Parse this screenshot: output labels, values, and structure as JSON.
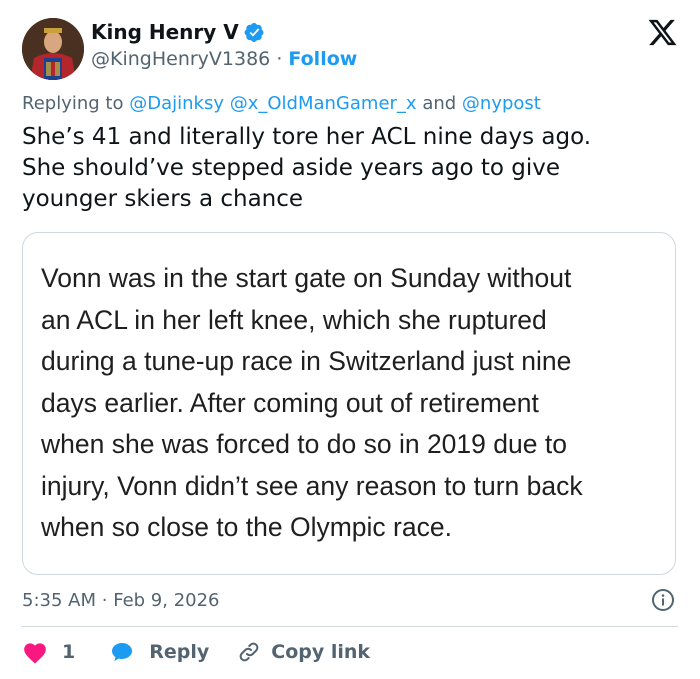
{
  "author": {
    "display_name": "King Henry V",
    "handle": "@KingHenryV1386",
    "separator": "·",
    "follow_label": "Follow",
    "verified": true,
    "avatar_icon": "royal-portrait-avatar"
  },
  "platform_icon": "x-logo-icon",
  "replying": {
    "prefix": "Replying to",
    "mention_1": "@Dajinksy",
    "mention_2": "@x_OldManGamer_x",
    "conjunction": "and",
    "mention_3": "@nypost"
  },
  "tweet": {
    "text": "She’s 41 and literally tore her ACL nine days ago.\nShe should’ve stepped aside years ago to give\nyounger skiers a chance"
  },
  "quoted_image": {
    "text": "Vonn was in the start gate on Sunday without\nan ACL in her left knee, which she ruptured\nduring a tune-up race in Switzerland just nine\ndays earlier. After coming out of retirement\nwhen she was forced to do so in 2019 due to\ninjury, Vonn didn’t see any reason to turn back\nwhen so close to the Olympic race."
  },
  "meta": {
    "time": "5:35 AM",
    "separator": "·",
    "date": "Feb 9, 2026"
  },
  "actions": {
    "like_count": "1",
    "reply_label": "Reply",
    "copy_link_label": "Copy link"
  },
  "colors": {
    "accent": "#1d9bf0",
    "like": "#f91880",
    "secondary_text": "#536471",
    "primary_text": "#0f1419"
  }
}
